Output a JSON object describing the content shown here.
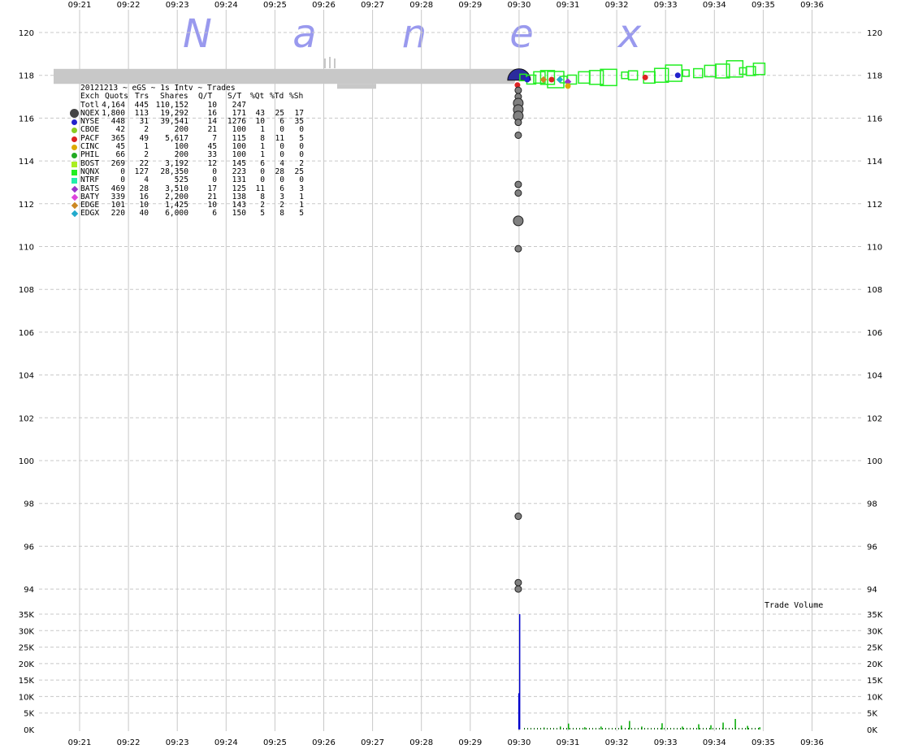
{
  "watermark": [
    "N",
    "a",
    "n",
    "e",
    "x"
  ],
  "chart_data": [
    {
      "type": "scatter",
      "title": "",
      "x_ticks": [
        "09:21",
        "09:22",
        "09:23",
        "09:24",
        "09:25",
        "09:26",
        "09:27",
        "09:28",
        "09:29",
        "09:30",
        "09:31",
        "09:32",
        "09:33",
        "09:34",
        "09:35",
        "09:36"
      ],
      "y_ticks": [
        "120",
        "118",
        "116",
        "114",
        "112",
        "110",
        "108",
        "106",
        "104",
        "102",
        "100",
        "98",
        "96",
        "94"
      ],
      "ylim": [
        93.2,
        120.6
      ],
      "grid": true,
      "pre_market_quote_band": {
        "start": "09:20:30",
        "end": "09:29:55",
        "low": 117.6,
        "high": 118.3,
        "color": "#c8c8c8"
      },
      "opening_trades_gray": [
        {
          "time": "09:30:00",
          "price": 117.3
        },
        {
          "time": "09:30:00",
          "price": 117.0
        },
        {
          "time": "09:30:00",
          "price": 116.7
        },
        {
          "time": "09:30:00",
          "price": 116.4
        },
        {
          "time": "09:30:00",
          "price": 116.1
        },
        {
          "time": "09:30:00",
          "price": 115.8
        },
        {
          "time": "09:30:00",
          "price": 115.2
        },
        {
          "time": "09:30:00",
          "price": 112.9
        },
        {
          "time": "09:30:00",
          "price": 112.5
        },
        {
          "time": "09:30:00",
          "price": 111.2
        },
        {
          "time": "09:30:00",
          "price": 109.9
        },
        {
          "time": "09:30:00",
          "price": 97.4
        },
        {
          "time": "09:30:00",
          "price": 94.3
        },
        {
          "time": "09:30:00",
          "price": 94.0
        }
      ],
      "post_open_trades": [
        {
          "time": "09:30:05",
          "price": 117.9,
          "exch": "NQNX"
        },
        {
          "time": "09:30:15",
          "price": 117.8,
          "exch": "NQNX"
        },
        {
          "time": "09:30:25",
          "price": 117.9,
          "exch": "NQNX"
        },
        {
          "time": "09:30:35",
          "price": 117.9,
          "exch": "NQNX"
        },
        {
          "time": "09:30:45",
          "price": 117.8,
          "exch": "NQNX"
        },
        {
          "time": "09:30:55",
          "price": 117.8,
          "exch": "NQNX"
        },
        {
          "time": "09:31:05",
          "price": 117.8,
          "exch": "NQNX"
        },
        {
          "time": "09:31:20",
          "price": 117.9,
          "exch": "NQNX"
        },
        {
          "time": "09:31:35",
          "price": 117.9,
          "exch": "NQNX"
        },
        {
          "time": "09:31:50",
          "price": 117.9,
          "exch": "NQNX"
        },
        {
          "time": "09:32:10",
          "price": 118.0,
          "exch": "NQNX"
        },
        {
          "time": "09:32:20",
          "price": 118.0,
          "exch": "NQNX"
        },
        {
          "time": "09:32:40",
          "price": 117.9,
          "exch": "NQNX"
        },
        {
          "time": "09:32:55",
          "price": 118.0,
          "exch": "NQNX"
        },
        {
          "time": "09:33:10",
          "price": 118.1,
          "exch": "NQNX"
        },
        {
          "time": "09:33:25",
          "price": 118.1,
          "exch": "NQNX"
        },
        {
          "time": "09:33:40",
          "price": 118.1,
          "exch": "NQNX"
        },
        {
          "time": "09:33:55",
          "price": 118.2,
          "exch": "NQNX"
        },
        {
          "time": "09:34:10",
          "price": 118.2,
          "exch": "NQNX"
        },
        {
          "time": "09:34:25",
          "price": 118.3,
          "exch": "NQNX"
        },
        {
          "time": "09:34:35",
          "price": 118.2,
          "exch": "NQNX"
        },
        {
          "time": "09:34:45",
          "price": 118.2,
          "exch": "NQNX"
        },
        {
          "time": "09:34:55",
          "price": 118.3,
          "exch": "NQNX"
        },
        {
          "time": "09:30:10",
          "price": 117.8,
          "exch": "NYSE"
        },
        {
          "time": "09:30:40",
          "price": 117.8,
          "exch": "PACF"
        },
        {
          "time": "09:31:00",
          "price": 117.7,
          "exch": "BATS"
        },
        {
          "time": "09:30:50",
          "price": 117.8,
          "exch": "EDGX"
        },
        {
          "time": "09:32:35",
          "price": 117.9,
          "exch": "PACF"
        },
        {
          "time": "09:33:15",
          "price": 118.0,
          "exch": "NYSE"
        },
        {
          "time": "09:30:30",
          "price": 117.8,
          "exch": "EDGE"
        },
        {
          "time": "09:31:00",
          "price": 117.5,
          "exch": "CINC"
        }
      ],
      "opening_fan": {
        "time": "09:30:00",
        "price": 118.0,
        "exch": "NQEX"
      }
    },
    {
      "type": "bar",
      "label": "Trade Volume",
      "y_ticks": [
        "35K",
        "30K",
        "25K",
        "20K",
        "15K",
        "10K",
        "5K",
        "0K"
      ],
      "ylim": [
        0,
        38000
      ],
      "bars": [
        {
          "time": "09:30:00",
          "value": 35000,
          "color": "#0000cc"
        },
        {
          "time": "09:29:59",
          "value": 11000,
          "color": "#0000cc"
        },
        {
          "time": "09:30:30",
          "value": 600,
          "color": "#00aa00"
        },
        {
          "time": "09:30:50",
          "value": 900,
          "color": "#00aa00"
        },
        {
          "time": "09:31:00",
          "value": 1800,
          "color": "#00aa00"
        },
        {
          "time": "09:31:20",
          "value": 700,
          "color": "#00aa00"
        },
        {
          "time": "09:31:40",
          "value": 900,
          "color": "#00aa00"
        },
        {
          "time": "09:32:05",
          "value": 1200,
          "color": "#00aa00"
        },
        {
          "time": "09:32:15",
          "value": 2600,
          "color": "#00aa00"
        },
        {
          "time": "09:32:30",
          "value": 900,
          "color": "#00aa00"
        },
        {
          "time": "09:32:55",
          "value": 1900,
          "color": "#00aa00"
        },
        {
          "time": "09:33:20",
          "value": 900,
          "color": "#00aa00"
        },
        {
          "time": "09:33:40",
          "value": 1600,
          "color": "#00aa00"
        },
        {
          "time": "09:33:55",
          "value": 1300,
          "color": "#00aa00"
        },
        {
          "time": "09:34:10",
          "value": 2100,
          "color": "#00aa00"
        },
        {
          "time": "09:34:25",
          "value": 3200,
          "color": "#00aa00"
        },
        {
          "time": "09:34:40",
          "value": 1100,
          "color": "#00aa00"
        },
        {
          "time": "09:34:55",
          "value": 700,
          "color": "#00aa00"
        }
      ]
    }
  ],
  "stats_table": {
    "header_line": "20121213 ~ eGS ~ 1s Intv ~ Trades",
    "columns": [
      "Exch",
      "Quots",
      "Trs",
      "Shares",
      "Q/T",
      "S/T",
      "%Qt",
      "%Td",
      "%Sh"
    ],
    "rows": [
      {
        "exch": "Totl",
        "quots": "4,164",
        "trs": "445",
        "shares": "110,152",
        "qt": "10",
        "st": "247",
        "pqt": "",
        "ptd": "",
        "psh": "",
        "color": "",
        "marker": "none"
      },
      {
        "exch": "NQEX",
        "quots": "1,800",
        "trs": "113",
        "shares": "19,292",
        "qt": "16",
        "st": "171",
        "pqt": "43",
        "ptd": "25",
        "psh": "17",
        "color": "#444444",
        "marker": "big"
      },
      {
        "exch": "NYSE",
        "quots": "448",
        "trs": "31",
        "shares": "39,541",
        "qt": "14",
        "st": "1276",
        "pqt": "10",
        "ptd": "6",
        "psh": "35",
        "color": "#2222cc",
        "marker": "dot"
      },
      {
        "exch": "CBOE",
        "quots": "42",
        "trs": "2",
        "shares": "200",
        "qt": "21",
        "st": "100",
        "pqt": "1",
        "ptd": "0",
        "psh": "0",
        "color": "#88cc22",
        "marker": "dot"
      },
      {
        "exch": "PACF",
        "quots": "365",
        "trs": "49",
        "shares": "5,617",
        "qt": "7",
        "st": "115",
        "pqt": "8",
        "ptd": "11",
        "psh": "5",
        "color": "#dd2222",
        "marker": "dot"
      },
      {
        "exch": "CINC",
        "quots": "45",
        "trs": "1",
        "shares": "100",
        "qt": "45",
        "st": "100",
        "pqt": "1",
        "ptd": "0",
        "psh": "0",
        "color": "#ddaa00",
        "marker": "dot"
      },
      {
        "exch": "PHIL",
        "quots": "66",
        "trs": "2",
        "shares": "200",
        "qt": "33",
        "st": "100",
        "pqt": "1",
        "ptd": "0",
        "psh": "0",
        "color": "#22aa22",
        "marker": "dot"
      },
      {
        "exch": "BOST",
        "quots": "269",
        "trs": "22",
        "shares": "3,192",
        "qt": "12",
        "st": "145",
        "pqt": "6",
        "ptd": "4",
        "psh": "2",
        "color": "#aaee22",
        "marker": "sq"
      },
      {
        "exch": "NQNX",
        "quots": "0",
        "trs": "127",
        "shares": "28,350",
        "qt": "0",
        "st": "223",
        "pqt": "0",
        "ptd": "28",
        "psh": "25",
        "color": "#22ee22",
        "marker": "sq"
      },
      {
        "exch": "NTRF",
        "quots": "0",
        "trs": "4",
        "shares": "525",
        "qt": "0",
        "st": "131",
        "pqt": "0",
        "ptd": "0",
        "psh": "0",
        "color": "#22eeaa",
        "marker": "sq"
      },
      {
        "exch": "BATS",
        "quots": "469",
        "trs": "28",
        "shares": "3,510",
        "qt": "17",
        "st": "125",
        "pqt": "11",
        "ptd": "6",
        "psh": "3",
        "color": "#9933cc",
        "marker": "dia"
      },
      {
        "exch": "BATY",
        "quots": "339",
        "trs": "16",
        "shares": "2,200",
        "qt": "21",
        "st": "138",
        "pqt": "8",
        "ptd": "3",
        "psh": "1",
        "color": "#dd44dd",
        "marker": "dia"
      },
      {
        "exch": "EDGE",
        "quots": "101",
        "trs": "10",
        "shares": "1,425",
        "qt": "10",
        "st": "143",
        "pqt": "2",
        "ptd": "2",
        "psh": "1",
        "color": "#cc8822",
        "marker": "dia"
      },
      {
        "exch": "EDGX",
        "quots": "220",
        "trs": "40",
        "shares": "6,000",
        "qt": "6",
        "st": "150",
        "pqt": "5",
        "ptd": "8",
        "psh": "5",
        "color": "#22aacc",
        "marker": "dia"
      }
    ]
  },
  "colors": {
    "grid": "#c8c8c8",
    "band": "#c8c8c8",
    "watermark": "#9999ee",
    "gray_trade": "#808080"
  }
}
